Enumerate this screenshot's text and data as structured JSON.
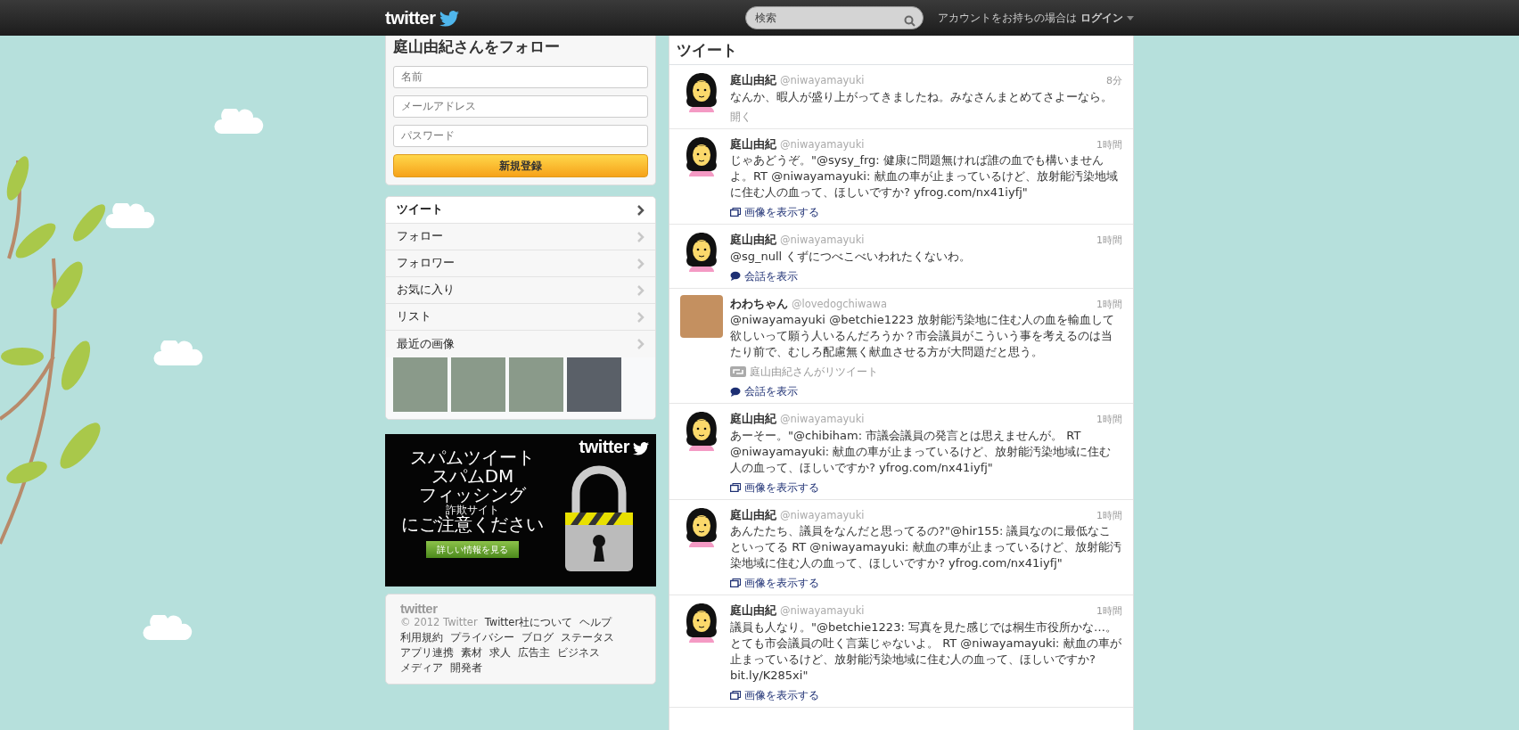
{
  "topbar": {
    "logo": "twitter",
    "search": {
      "placeholder": "検索"
    },
    "login": "アカウントをお持ちの場合は **ログイン**"
  },
  "signup": {
    "title": "庭山由紀さんをフォロー",
    "fields": [
      {
        "placeholder": "名前"
      },
      {
        "placeholder": "メールアドレス"
      },
      {
        "placeholder": "パスワード"
      }
    ],
    "button": "新規登録"
  },
  "profile_nav": [
    {
      "label": "ツイート",
      "selected": true
    },
    {
      "label": "フォロー",
      "selected": false
    },
    {
      "label": "フォロワー",
      "selected": false
    },
    {
      "label": "お気に入り",
      "selected": false
    },
    {
      "label": "リスト",
      "selected": false
    },
    {
      "label": "最近の画像",
      "selected": false,
      "kind": "images"
    }
  ],
  "ad": {
    "logo": "twitter",
    "lines": [
      {
        "text": "スパムツイート",
        "kind": "large"
      },
      {
        "text": "スパムDM",
        "kind": "large"
      },
      {
        "text": "フィッシング",
        "kind": "large"
      },
      {
        "text": "詐欺サイト",
        "kind": "small"
      },
      {
        "text": "にご注意ください",
        "kind": "large"
      }
    ],
    "button": "詳しい情報を見る"
  },
  "footer": {
    "logo": "twitter",
    "lines": [
      [
        "© 2012 Twitter",
        "Twitter社について",
        "ヘルプ"
      ],
      [
        "利用規約",
        "プライバシー",
        "ブログ",
        "ステータス"
      ],
      [
        "アプリ連携",
        "素材",
        "求人",
        "広告主",
        "ビジネス"
      ],
      [
        "メディア",
        "開発者"
      ]
    ]
  },
  "timeline": {
    "title": "ツイート",
    "tweets": [
      {
        "name": "庭山由紀",
        "handle": "@niwayamayuki",
        "time": "8分",
        "photo_avatar": false,
        "text": [
          {
            "kind": "text",
            "text": "なんか、暇人が盛り上がってきましたね。みなさんまとめてさよーなら。"
          }
        ],
        "actions": [
          {
            "kind": "open",
            "label": "開く"
          }
        ]
      },
      {
        "name": "庭山由紀",
        "handle": "@niwayamayuki",
        "time": "1時間",
        "photo_avatar": false,
        "text": [
          {
            "kind": "text",
            "text": "じゃあどうぞ。\""
          },
          {
            "kind": "link",
            "text": "@sysy_frg:"
          },
          {
            "kind": "text",
            "text": " 健康に問題無ければ誰の血でも構いませんよ。RT "
          },
          {
            "kind": "link",
            "text": "@niwayamayuki:"
          },
          {
            "kind": "text",
            "text": " 献血の車が止まっているけど、放射能汚染地域に住む人の血って、ほしいですか? "
          },
          {
            "kind": "link",
            "text": "yfrog.com/nx41iyfj"
          },
          {
            "kind": "text",
            "text": "\""
          }
        ],
        "actions": [
          {
            "kind": "media",
            "label": "画像を表示する"
          }
        ]
      },
      {
        "name": "庭山由紀",
        "handle": "@niwayamayuki",
        "time": "1時間",
        "photo_avatar": false,
        "text": [
          {
            "kind": "link",
            "text": "@sg_null"
          },
          {
            "kind": "text",
            "text": " くずにつべこべいわれたくないわ。"
          }
        ],
        "actions": [
          {
            "kind": "conversation",
            "label": "会話を表示"
          }
        ]
      },
      {
        "name": "わわちゃん",
        "handle": "@lovedogchiwawa",
        "time": "1時間",
        "photo_avatar": true,
        "text": [
          {
            "kind": "link",
            "text": "@niwayamayuki"
          },
          {
            "kind": "link",
            "text": "@betchie1223"
          },
          {
            "kind": "text",
            "text": " 放射能汚染地に住む人の血を輸血して欲しいって願う人いるんだろうか？市会議員がこういう事を考えるのは当たり前で、むしろ配慮無く献血させる方が大問題だと思う。"
          }
        ],
        "actions": [
          {
            "kind": "retweeted",
            "label": "庭山由紀さんがリツイート"
          },
          {
            "kind": "conversation",
            "label": "会話を表示"
          }
        ]
      },
      {
        "name": "庭山由紀",
        "handle": "@niwayamayuki",
        "time": "1時間",
        "photo_avatar": false,
        "text": [
          {
            "kind": "text",
            "text": "あーそー。\""
          },
          {
            "kind": "link",
            "text": "@chibiham:"
          },
          {
            "kind": "text",
            "text": " 市議会議員の発言とは思えませんが。 RT "
          },
          {
            "kind": "link",
            "text": "@niwayamayuki:"
          },
          {
            "kind": "text",
            "text": " 献血の車が止まっているけど、放射能汚染地域に住む人の血って、ほしいですか? "
          },
          {
            "kind": "link",
            "text": "yfrog.com/nx41iyfj"
          },
          {
            "kind": "text",
            "text": "\""
          }
        ],
        "actions": [
          {
            "kind": "media",
            "label": "画像を表示する"
          }
        ]
      },
      {
        "name": "庭山由紀",
        "handle": "@niwayamayuki",
        "time": "1時間",
        "photo_avatar": false,
        "text": [
          {
            "kind": "text",
            "text": "あんたたち、議員をなんだと思ってるの?\""
          },
          {
            "kind": "link",
            "text": "@hir155:"
          },
          {
            "kind": "text",
            "text": " 議員なのに最低なこといってる RT "
          },
          {
            "kind": "link",
            "text": "@niwayamayuki:"
          },
          {
            "kind": "text",
            "text": " 献血の車が止まっているけど、放射能汚染地域に住む人の血って、ほしいですか? "
          },
          {
            "kind": "link",
            "text": "yfrog.com/nx41iyfj"
          },
          {
            "kind": "text",
            "text": "\""
          }
        ],
        "actions": [
          {
            "kind": "media",
            "label": "画像を表示する"
          }
        ]
      },
      {
        "name": "庭山由紀",
        "handle": "@niwayamayuki",
        "time": "1時間",
        "photo_avatar": false,
        "text": [
          {
            "kind": "text",
            "text": "議員も人なり。\""
          },
          {
            "kind": "link",
            "text": "@betchie1223:"
          },
          {
            "kind": "text",
            "text": " 写真を見た感じでは桐生市役所かな…。とても市会議員の吐く言葉じゃないよ。 RT "
          },
          {
            "kind": "link",
            "text": "@niwayamayuki:"
          },
          {
            "kind": "text",
            "text": " 献血の車が止まっているけど、放射能汚染地域に住む人の血って、ほしいですか? "
          },
          {
            "kind": "link",
            "text": "bit.ly/K285xi"
          },
          {
            "kind": "text",
            "text": "\""
          }
        ],
        "actions": [
          {
            "kind": "media",
            "label": "画像を表示する"
          }
        ]
      }
    ]
  }
}
